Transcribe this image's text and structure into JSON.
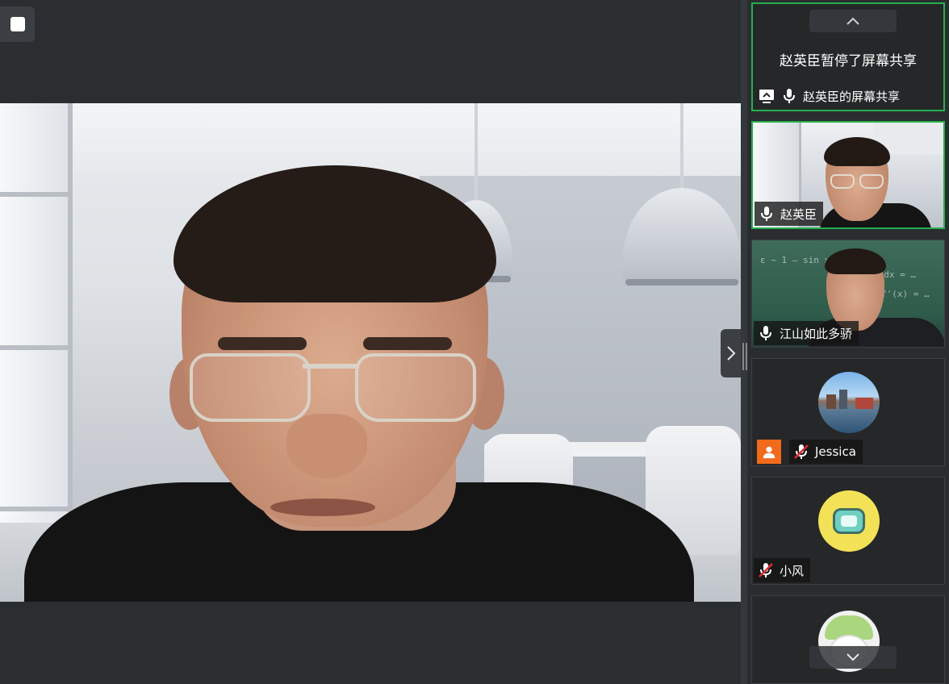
{
  "stage": {
    "stop_share_icon": "stop-square-icon",
    "main_speaker": "赵英臣"
  },
  "panel": {
    "scroll_up_icon": "chevron-up-icon",
    "scroll_down_icon": "chevron-down-icon",
    "collapse_icon": "chevron-right-icon",
    "share_tile": {
      "message": "赵英臣暂停了屏幕共享",
      "label": "赵英臣的屏幕共享",
      "icons": [
        "screen-share-icon",
        "microphone-icon"
      ]
    },
    "participants": [
      {
        "name": "赵英臣",
        "mic": "microphone-icon",
        "muted": false,
        "type": "video"
      },
      {
        "name": "江山如此多骄",
        "mic": "microphone-icon",
        "muted": false,
        "type": "video"
      },
      {
        "name": "Jessica",
        "mic": "microphone-muted-icon",
        "muted": true,
        "type": "avatar",
        "badge": "user-avatar-icon"
      },
      {
        "name": "小风",
        "mic": "microphone-muted-icon",
        "muted": true,
        "type": "avatar"
      },
      {
        "name": "",
        "mic": "microphone-muted-icon",
        "muted": true,
        "type": "avatar"
      }
    ]
  },
  "colors": {
    "active_border": "#23b14d",
    "background": "#2a2d30",
    "muted_red": "#e02b2b",
    "avatar_orange": "#f26a1b"
  }
}
